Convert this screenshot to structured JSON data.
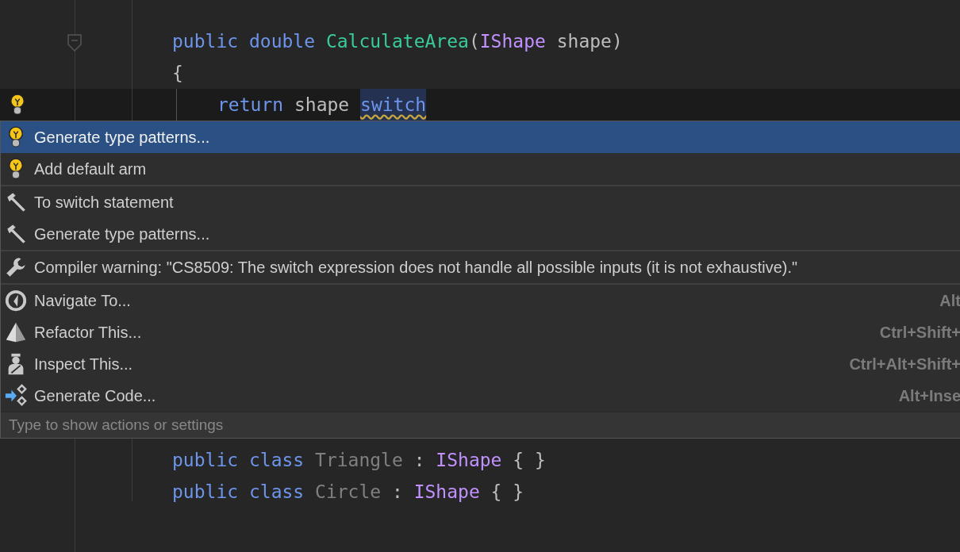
{
  "code_top": [
    {
      "tokens": [
        {
          "kind": "keyword",
          "text": "public"
        },
        {
          "kind": "keyword",
          "text": "double"
        },
        {
          "kind": "method",
          "text": "CalculateArea"
        },
        {
          "kind": "punct",
          "text": "("
        },
        {
          "kind": "interface",
          "text": "IShape"
        },
        {
          "kind": "plain",
          "text": "shape"
        },
        {
          "kind": "punct",
          "text": ")"
        }
      ],
      "indent": false,
      "current": false
    },
    {
      "tokens": [
        {
          "kind": "punct",
          "text": "{"
        }
      ],
      "indent": false,
      "current": false
    },
    {
      "tokens": [
        {
          "kind": "keyword",
          "text": "return"
        },
        {
          "kind": "plain",
          "text": "shape"
        },
        {
          "kind": "keyword",
          "text": "switch",
          "warning": true
        }
      ],
      "indent": true,
      "current": true
    }
  ],
  "actions": [
    {
      "group": [
        {
          "kind": "bulb",
          "label": "Generate type patterns...",
          "selected": true
        },
        {
          "kind": "bulb",
          "label": "Add default arm",
          "selected": false
        }
      ]
    },
    {
      "group": [
        {
          "kind": "hammer",
          "label": "To switch statement",
          "selected": false
        },
        {
          "kind": "hammer",
          "label": "Generate type patterns...",
          "selected": false
        }
      ]
    },
    {
      "group": [
        {
          "kind": "wrench",
          "label": "Compiler warning: \"CS8509: The switch expression does not handle all possible inputs (it is not exhaustive).\"",
          "selected": false
        }
      ]
    },
    {
      "group": [
        {
          "kind": "compass",
          "label": "Navigate To...",
          "shortcut": "Alt",
          "selected": false
        },
        {
          "kind": "pyramid",
          "label": "Refactor This...",
          "shortcut": "Ctrl+Shift+",
          "selected": false
        },
        {
          "kind": "inspector",
          "label": "Inspect This...",
          "shortcut": "Ctrl+Alt+Shift+",
          "selected": false
        },
        {
          "kind": "generate",
          "label": "Generate Code...",
          "shortcut": "Alt+Inse",
          "selected": false
        }
      ]
    }
  ],
  "search": {
    "placeholder": "Type to show actions or settings"
  },
  "code_bottom": [
    {
      "tokens": [
        {
          "kind": "keyword",
          "text": "public"
        },
        {
          "kind": "keyword",
          "text": "class"
        },
        {
          "kind": "unused",
          "text": "Triangle"
        },
        {
          "kind": "punct",
          "text": ":"
        },
        {
          "kind": "interface",
          "text": "IShape"
        },
        {
          "kind": "punct",
          "text": "{"
        },
        {
          "kind": "punct",
          "text": "}"
        }
      ]
    },
    {
      "tokens": [
        {
          "kind": "keyword",
          "text": "public"
        },
        {
          "kind": "keyword",
          "text": "class"
        },
        {
          "kind": "unused",
          "text": "Circle"
        },
        {
          "kind": "punct",
          "text": ":"
        },
        {
          "kind": "interface",
          "text": "IShape"
        },
        {
          "kind": "punct",
          "text": "{"
        },
        {
          "kind": "punct",
          "text": "}"
        }
      ]
    }
  ]
}
